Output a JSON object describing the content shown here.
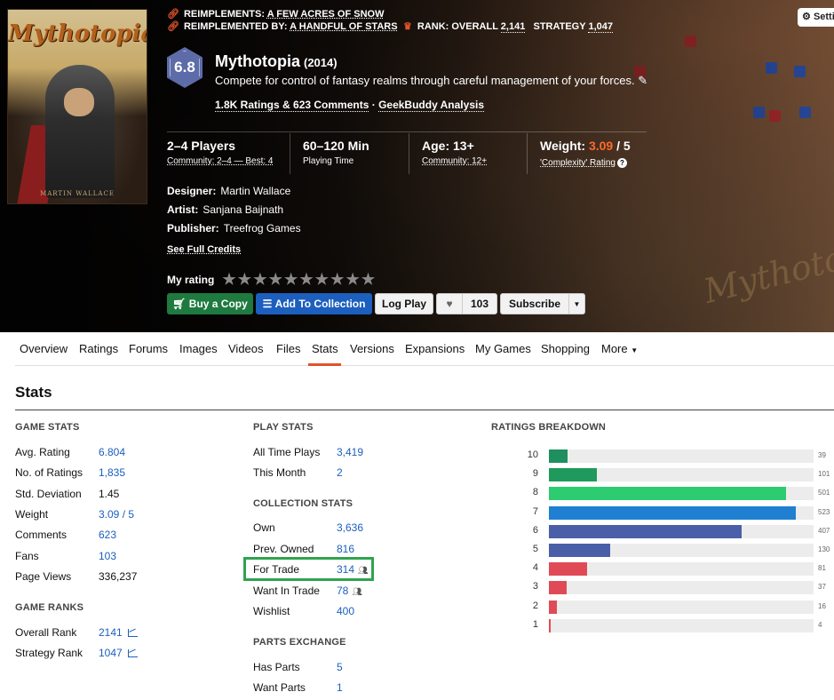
{
  "hero": {
    "cover_title": "Mythotopia",
    "cover_author": "MARTIN WALLACE",
    "map_title": "Mythotopia",
    "reimplements_label": "REIMPLEMENTS:",
    "reimplements_value": "A FEW ACRES OF SNOW",
    "reimplemented_by_label": "REIMPLEMENTED BY:",
    "reimplemented_by_value": "A HANDFUL OF STARS",
    "rank_label": "RANK: OVERALL",
    "rank_overall": "2,141",
    "rank_strategy_label": "STRATEGY",
    "rank_strategy": "1,047",
    "settings_label": "Setti",
    "rating": "6.8",
    "title": "Mythotopia",
    "year": "(2014)",
    "description": "Compete for control of fantasy realms through careful management of your forces.",
    "ratings_comments": "1.8K Ratings & 623 Comments",
    "geekbuddy": "GeekBuddy Analysis",
    "players": "2–4 Players",
    "players_community": "Community: 2–4 — Best: 4",
    "playtime": "60–120 Min",
    "playtime_label": "Playing Time",
    "age": "Age: 13+",
    "age_community": "Community: 12+",
    "weight_label": "Weight:",
    "weight_value": "3.09",
    "weight_max": "/ 5",
    "complexity_label": "'Complexity' Rating",
    "designer_label": "Designer:",
    "designer": "Martin Wallace",
    "artist_label": "Artist:",
    "artist": "Sanjana Baijnath",
    "publisher_label": "Publisher:",
    "publisher": "Treefrog Games",
    "see_full_credits": "See Full Credits",
    "my_rating_label": "My rating",
    "buttons": {
      "buy": "Buy a Copy",
      "collection": "Add To Collection",
      "log_play": "Log Play",
      "fans_count": "103",
      "subscribe": "Subscribe"
    }
  },
  "nav": {
    "items": [
      "Overview",
      "Ratings",
      "Forums",
      "Images",
      "Videos",
      "Files",
      "Stats",
      "Versions",
      "Expansions",
      "My Games",
      "Shopping",
      "More"
    ],
    "active": "Stats"
  },
  "stats": {
    "title": "Stats",
    "game_stats_head": "GAME STATS",
    "game_stats": [
      {
        "label": "Avg. Rating",
        "value": "6.804"
      },
      {
        "label": "No. of Ratings",
        "value": "1,835"
      },
      {
        "label": "Std. Deviation",
        "value": "1.45"
      },
      {
        "label": "Weight",
        "value": "3.09 / 5"
      },
      {
        "label": "Comments",
        "value": "623"
      },
      {
        "label": "Fans",
        "value": "103"
      },
      {
        "label": "Page Views",
        "value": "336,237"
      }
    ],
    "game_ranks_head": "GAME RANKS",
    "game_ranks": [
      {
        "label": "Overall Rank",
        "value": "2141"
      },
      {
        "label": "Strategy Rank",
        "value": "1047"
      }
    ],
    "play_stats_head": "PLAY STATS",
    "play_stats": [
      {
        "label": "All Time Plays",
        "value": "3,419"
      },
      {
        "label": "This Month",
        "value": "2"
      }
    ],
    "collection_head": "COLLECTION STATS",
    "collection": [
      {
        "label": "Own",
        "value": "3,636"
      },
      {
        "label": "Prev. Owned",
        "value": "816"
      },
      {
        "label": "For Trade",
        "value": "314"
      },
      {
        "label": "Want In Trade",
        "value": "78"
      },
      {
        "label": "Wishlist",
        "value": "400"
      }
    ],
    "parts_head": "PARTS EXCHANGE",
    "parts": [
      {
        "label": "Has Parts",
        "value": "5"
      },
      {
        "label": "Want Parts",
        "value": "1"
      }
    ],
    "breakdown_head": "RATINGS BREAKDOWN"
  },
  "chart_data": {
    "type": "bar",
    "orientation": "horizontal",
    "title": "RATINGS BREAKDOWN",
    "categories": [
      "10",
      "9",
      "8",
      "7",
      "6",
      "5",
      "4",
      "3",
      "2",
      "1"
    ],
    "values": [
      39,
      101,
      501,
      523,
      407,
      130,
      81,
      37,
      16,
      4
    ],
    "colors": [
      "#1f8f5f",
      "#1f9a5c",
      "#2ecc71",
      "#1f7fd1",
      "#4a5fa8",
      "#4a5fa8",
      "#e04a56",
      "#e04a56",
      "#e04a56",
      "#e04a56"
    ],
    "xlim": [
      0,
      560
    ]
  },
  "colors": {
    "accent": "#e0522c",
    "link": "#1c5fbe",
    "green_button": "#1f7a3f",
    "blue_button": "#1c5fbe",
    "rating_hex": "#5d6ca8",
    "highlight": "#2ea44f"
  }
}
